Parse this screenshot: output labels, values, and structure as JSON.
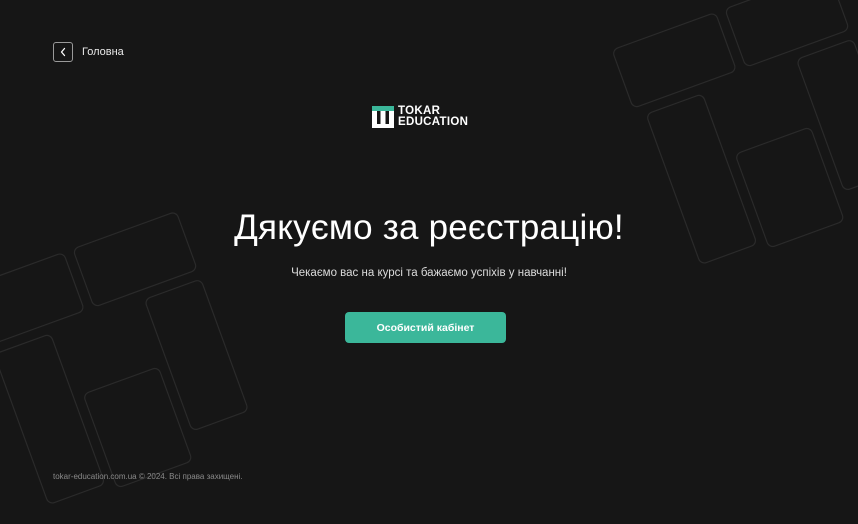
{
  "nav": {
    "back_label": "Головна"
  },
  "logo": {
    "line1": "TOKAR",
    "line2": "EDUCATION"
  },
  "main": {
    "title": "Дякуємо за реєстрацію!",
    "subtitle": "Чекаємо вас на курсі та бажаємо успіхів у навчанні!",
    "cta_label": "Особистий кабінет"
  },
  "footer": {
    "copyright": "tokar-education.com.ua © 2024. Всі права захищені."
  },
  "colors": {
    "background": "#161616",
    "accent": "#3bb79a",
    "text": "#ffffff"
  },
  "icons": {
    "back": "chevron-left-icon",
    "logo_mark": "tokar-logo-mark"
  }
}
